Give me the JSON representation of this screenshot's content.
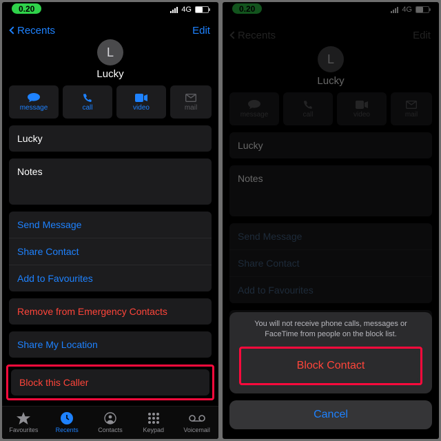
{
  "colors": {
    "accent": "#1e82ff",
    "destructive": "#ff453a",
    "highlight": "#ff0a3c"
  },
  "status": {
    "time": "0.20",
    "network": "4G"
  },
  "nav": {
    "back": "Recents",
    "edit": "Edit"
  },
  "contact": {
    "initial": "L",
    "name": "Lucky"
  },
  "actions": {
    "message": "message",
    "call": "call",
    "video": "video",
    "mail": "mail"
  },
  "fields": {
    "name_repeat": "Lucky",
    "notes_label": "Notes"
  },
  "links": {
    "send_message": "Send Message",
    "share_contact": "Share Contact",
    "add_fav": "Add to Favourites",
    "remove_emergency": "Remove from Emergency Contacts",
    "share_location": "Share My Location",
    "block_caller": "Block this Caller"
  },
  "tabs": {
    "favourites": "Favourites",
    "recents": "Recents",
    "contacts": "Contacts",
    "keypad": "Keypad",
    "voicemail": "Voicemail"
  },
  "sheet": {
    "message": "You will not receive phone calls, messages or FaceTime from people on the block list.",
    "block": "Block Contact",
    "cancel": "Cancel"
  }
}
